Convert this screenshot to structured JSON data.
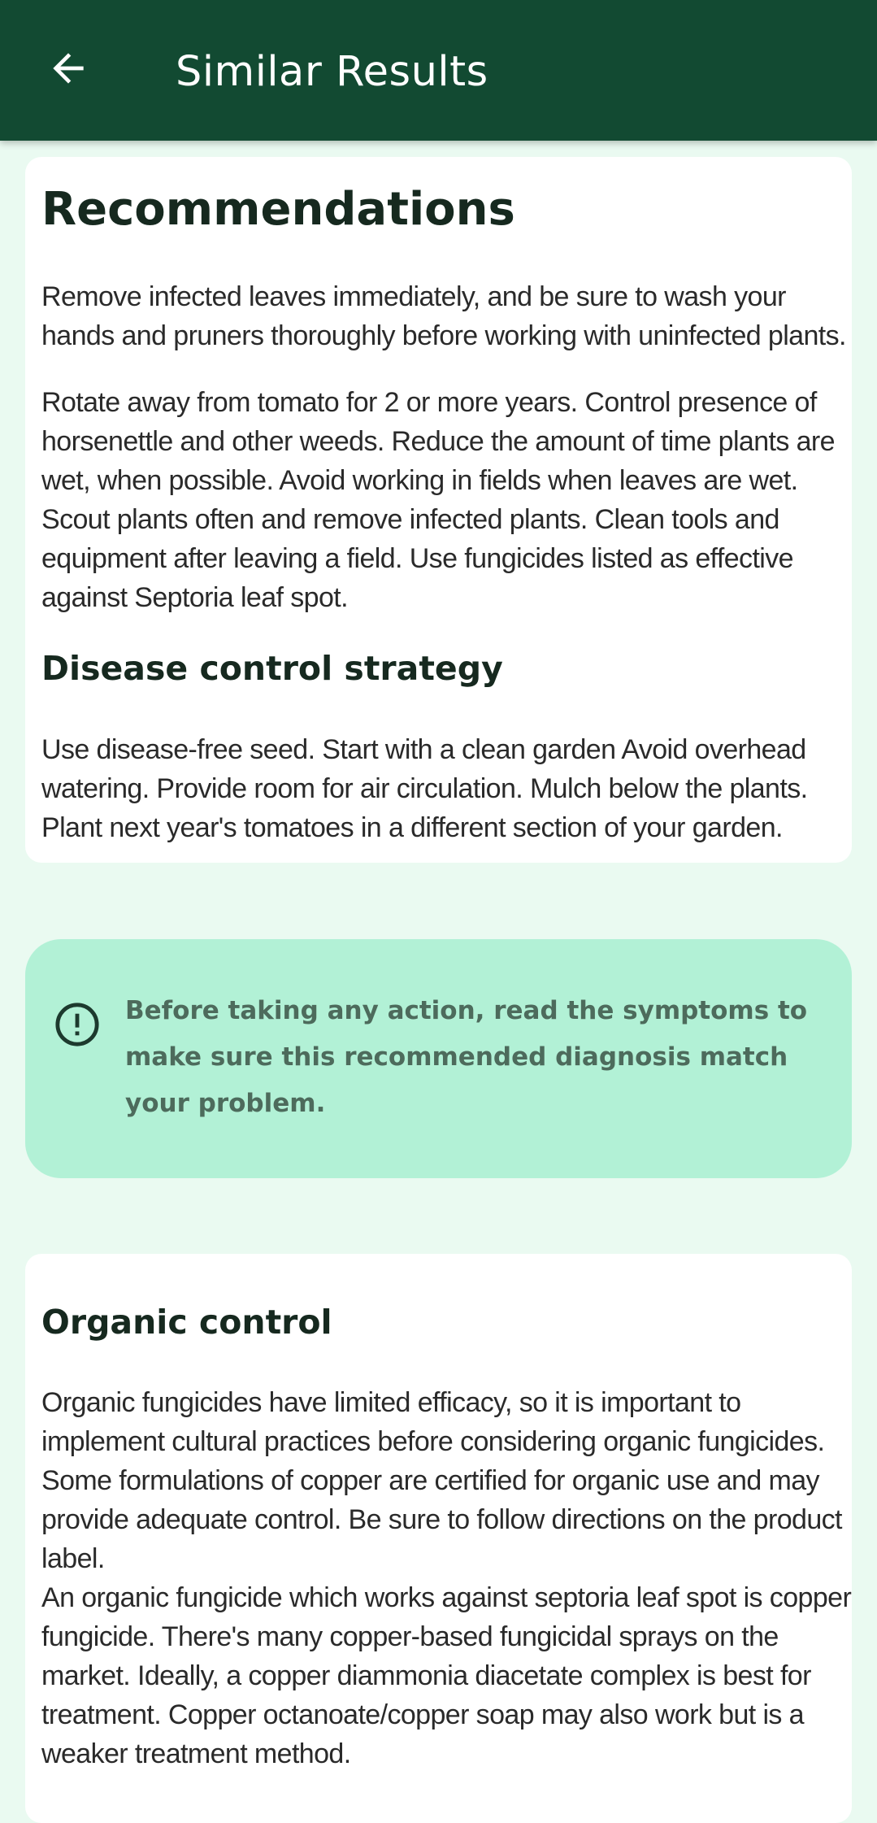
{
  "appbar": {
    "title": "Similar Results",
    "back_icon": "arrow-left-icon"
  },
  "recommendations": {
    "title": "Recommendations",
    "paragraph1": "Remove infected leaves immediately, and be sure to wash your hands and pruners thoroughly before working with uninfected plants.",
    "paragraph2": "Rotate away from tomato for 2 or more years. Control presence of horsenettle and other weeds. Reduce the amount of time plants are wet, when possible. Avoid working in fields when leaves are wet. Scout plants often and remove infected plants. Clean tools and equipment after leaving a field. Use fungicides listed as effective against Septoria leaf spot.",
    "strategy_title": "Disease control strategy",
    "strategy_text": "Use disease-free seed. Start with a clean garden Avoid overhead watering. Provide room for air circulation. Mulch below the plants. Plant next year's tomatoes in a different section of your garden."
  },
  "alert": {
    "icon": "exclamation-circle-icon",
    "text": "Before taking any action, read the symptoms to make sure this recommended diagnosis match your problem."
  },
  "organic": {
    "title": "Organic control",
    "paragraph1": "Organic fungicides have limited efficacy, so it is important to implement cultural practices before considering organic fungicides. Some formulations of copper are certified for organic use and may provide adequate control. Be sure to follow directions on the product label.",
    "paragraph2": "An organic fungicide which works against septoria leaf spot is copper fungicide. There's many copper-based fungicidal sprays on the market. Ideally, a copper diammonia diacetate complex is best for treatment. Copper octanoate/copper soap may also work but is a weaker treatment method."
  },
  "colors": {
    "appbar": "#124a32",
    "background": "#eafaf1",
    "alert_background": "#b2f1d6",
    "alert_text": "#4d6b5c",
    "heading": "#16291f"
  }
}
